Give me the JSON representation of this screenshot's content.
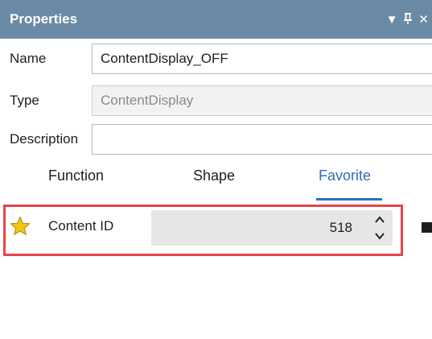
{
  "panel": {
    "title": "Properties",
    "controls": {
      "dropdown": "▼",
      "pin": "ᚋ",
      "close": "✕"
    }
  },
  "fields": {
    "name": {
      "label": "Name",
      "value": "ContentDisplay_OFF"
    },
    "type": {
      "label": "Type",
      "value": "ContentDisplay"
    },
    "description": {
      "label": "Description",
      "value": ""
    }
  },
  "tabs": [
    {
      "label": "Function"
    },
    {
      "label": "Shape"
    },
    {
      "label": "Favorite"
    }
  ],
  "active_tab": "Favorite",
  "favorites": [
    {
      "label": "Content ID",
      "value": "518",
      "icon": "star-icon"
    }
  ],
  "colors": {
    "titlebar": "#6b8aa6",
    "accent": "#2f6fb8",
    "highlight": "#e8444c",
    "star": "#f5c518"
  }
}
